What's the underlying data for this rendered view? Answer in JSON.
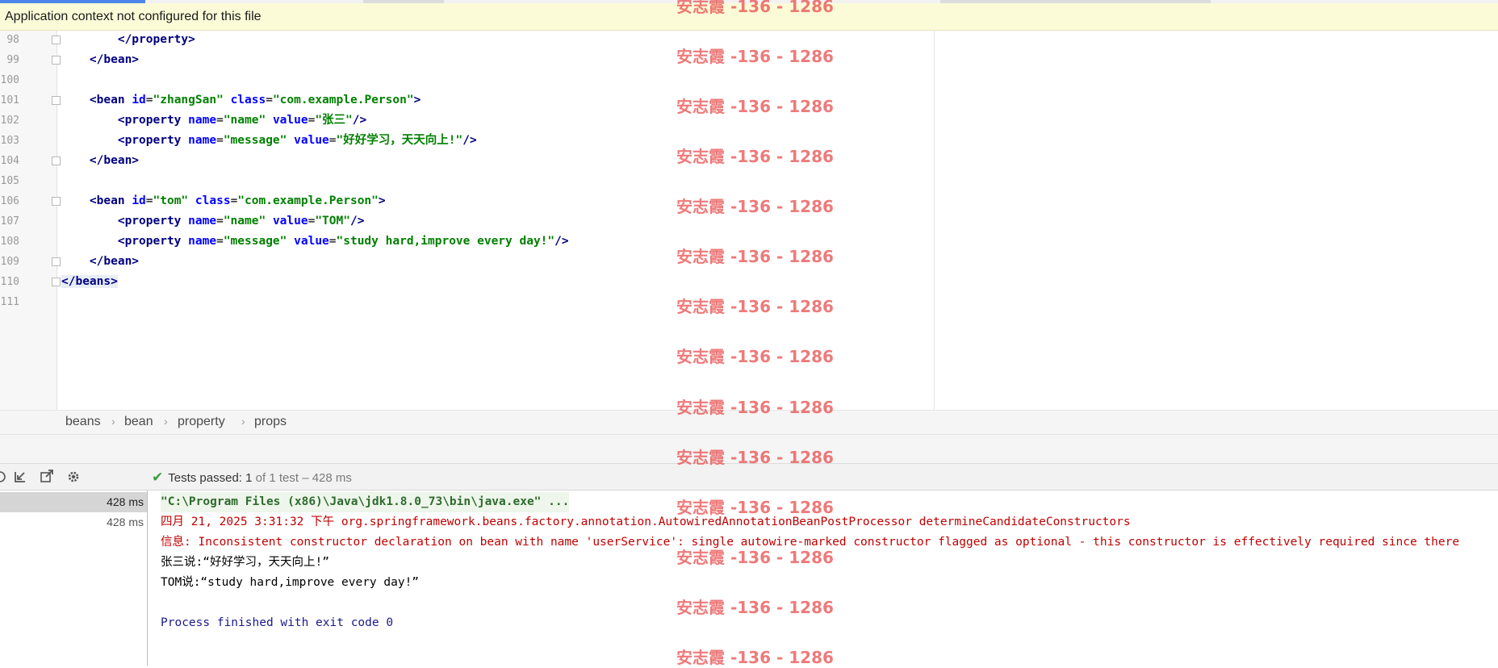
{
  "banner": {
    "message": "Application context not configured for this file"
  },
  "editor": {
    "lines": [
      {
        "no": "98",
        "indent": "        ",
        "tokens": [
          [
            "t-tag",
            "</property>"
          ]
        ]
      },
      {
        "no": "99",
        "indent": "    ",
        "tokens": [
          [
            "t-tag",
            "</bean>"
          ]
        ]
      },
      {
        "no": "100",
        "indent": "",
        "tokens": []
      },
      {
        "no": "101",
        "indent": "    ",
        "tokens": [
          [
            "t-tag",
            "<bean "
          ],
          [
            "t-attr",
            "id"
          ],
          [
            "t-punct",
            "="
          ],
          [
            "t-val",
            "\"zhangSan\""
          ],
          [
            "t-punct",
            " "
          ],
          [
            "t-attr",
            "class"
          ],
          [
            "t-punct",
            "="
          ],
          [
            "t-val",
            "\"com.example.Person\""
          ],
          [
            "t-tag",
            ">"
          ]
        ]
      },
      {
        "no": "102",
        "indent": "        ",
        "tokens": [
          [
            "t-tag",
            "<property "
          ],
          [
            "t-attr",
            "name"
          ],
          [
            "t-punct",
            "="
          ],
          [
            "t-val",
            "\"name\""
          ],
          [
            "t-punct",
            " "
          ],
          [
            "t-attr",
            "value"
          ],
          [
            "t-punct",
            "="
          ],
          [
            "t-val",
            "\"张三\""
          ],
          [
            "t-tag",
            "/>"
          ]
        ]
      },
      {
        "no": "103",
        "indent": "        ",
        "tokens": [
          [
            "t-tag",
            "<property "
          ],
          [
            "t-attr",
            "name"
          ],
          [
            "t-punct",
            "="
          ],
          [
            "t-val",
            "\"message\""
          ],
          [
            "t-punct",
            " "
          ],
          [
            "t-attr",
            "value"
          ],
          [
            "t-punct",
            "="
          ],
          [
            "t-val",
            "\"好好学习，天天向上!\""
          ],
          [
            "t-tag",
            "/>"
          ]
        ]
      },
      {
        "no": "104",
        "indent": "    ",
        "tokens": [
          [
            "t-tag",
            "</bean>"
          ]
        ]
      },
      {
        "no": "105",
        "indent": "",
        "tokens": []
      },
      {
        "no": "106",
        "indent": "    ",
        "tokens": [
          [
            "t-tag",
            "<bean "
          ],
          [
            "t-attr",
            "id"
          ],
          [
            "t-punct",
            "="
          ],
          [
            "t-val",
            "\"tom\""
          ],
          [
            "t-punct",
            " "
          ],
          [
            "t-attr",
            "class"
          ],
          [
            "t-punct",
            "="
          ],
          [
            "t-val",
            "\"com.example.Person\""
          ],
          [
            "t-tag",
            ">"
          ]
        ]
      },
      {
        "no": "107",
        "indent": "        ",
        "tokens": [
          [
            "t-tag",
            "<property "
          ],
          [
            "t-attr",
            "name"
          ],
          [
            "t-punct",
            "="
          ],
          [
            "t-val",
            "\"name\""
          ],
          [
            "t-punct",
            " "
          ],
          [
            "t-attr",
            "value"
          ],
          [
            "t-punct",
            "="
          ],
          [
            "t-val",
            "\"TOM\""
          ],
          [
            "t-tag",
            "/>"
          ]
        ]
      },
      {
        "no": "108",
        "indent": "        ",
        "tokens": [
          [
            "t-tag",
            "<property "
          ],
          [
            "t-attr",
            "name"
          ],
          [
            "t-punct",
            "="
          ],
          [
            "t-val",
            "\"message\""
          ],
          [
            "t-punct",
            " "
          ],
          [
            "t-attr",
            "value"
          ],
          [
            "t-punct",
            "="
          ],
          [
            "t-val",
            "\"study hard,improve every day!\""
          ],
          [
            "t-tag",
            "/>"
          ]
        ]
      },
      {
        "no": "109",
        "indent": "    ",
        "tokens": [
          [
            "t-tag",
            "</bean>"
          ]
        ]
      },
      {
        "no": "110",
        "indent": "",
        "tokens": [
          [
            "t-tag hl-beans",
            "</beans>"
          ]
        ]
      },
      {
        "no": "111",
        "indent": "",
        "tokens": []
      }
    ]
  },
  "breadcrumb": {
    "items": [
      "beans",
      "bean",
      "property",
      "props"
    ]
  },
  "run_toolbar": {
    "tests_passed_label": "Tests passed:",
    "tests_passed_count": "1",
    "tests_summary": "of 1 test – 428 ms"
  },
  "test_tree": {
    "rows": [
      "428 ms",
      "428 ms"
    ]
  },
  "console": {
    "lines": [
      {
        "style": "c-cmd",
        "text": "\"C:\\Program Files (x86)\\Java\\jdk1.8.0_73\\bin\\java.exe\" ..."
      },
      {
        "style": "c-red",
        "text": "四月 21, 2025 3:31:32 下午 org.springframework.beans.factory.annotation.AutowiredAnnotationBeanPostProcessor determineCandidateConstructors"
      },
      {
        "style": "c-red",
        "text": "信息: Inconsistent constructor declaration on bean with name 'userService': single autowire-marked constructor flagged as optional - this constructor is effectively required since there"
      },
      {
        "style": "c-black",
        "text": "张三说:“好好学习，天天向上!”"
      },
      {
        "style": "c-black",
        "text": "TOM说:“study hard,improve every day!”"
      },
      {
        "style": "c-black",
        "text": ""
      },
      {
        "style": "c-blue",
        "text": "Process finished with exit code 0"
      }
    ]
  },
  "watermark": {
    "text": "安志霞 -136 - 1286",
    "color": "#e84646"
  },
  "colors": {
    "tag": "#000080",
    "attribute": "#0000ff",
    "value": "#008000",
    "banner_bg": "#fcfbd8",
    "error_text": "#c00000",
    "exit_text": "#1a1a8c",
    "pass_check": "#3d9a3d"
  },
  "icons": [
    "scroll-up-icon",
    "collapse-icon",
    "export-icon",
    "settings-gear-icon",
    "check-icon"
  ]
}
